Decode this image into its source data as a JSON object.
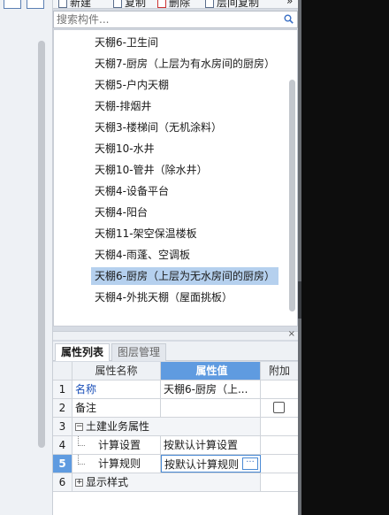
{
  "toolbar": {
    "new_label": "新建",
    "copy_label": "复制",
    "delete_label": "删除",
    "floor_copy_label": "层间复制",
    "more_label": "»"
  },
  "search": {
    "placeholder": "搜索构件..."
  },
  "components": [
    "天棚6-卫生间",
    "天棚7-厨房（上层为有水房间的厨房）",
    "天棚5-户内天棚",
    "天棚-排烟井",
    "天棚3-楼梯间（无机涂料）",
    "天棚10-水井",
    "天棚10-管井（除水井）",
    "天棚4-设备平台",
    "天棚4-阳台",
    "天棚11-架空保温楼板",
    "天棚4-雨蓬、空调板",
    "天棚6-厨房（上层为无水房间的厨房）",
    "天棚4-外挑天棚（屋面挑板）"
  ],
  "selected_index": 11,
  "props": {
    "tabs": [
      "属性列表",
      "图层管理"
    ],
    "headers": {
      "name": "属性名称",
      "value": "属性值",
      "add": "附加"
    },
    "rows": [
      {
        "num": "1",
        "name": "名称",
        "value": "天棚6-厨房（上..."
      },
      {
        "num": "2",
        "name": "备注",
        "value": ""
      },
      {
        "num": "3",
        "name": "土建业务属性",
        "value": ""
      },
      {
        "num": "4",
        "name": "计算设置",
        "value": "按默认计算设置"
      },
      {
        "num": "5",
        "name": "计算规则",
        "value": "按默认计算规则"
      },
      {
        "num": "6",
        "name": "显示样式",
        "value": ""
      }
    ],
    "close_label": "×",
    "ellipsis_label": "···"
  },
  "colors": {
    "selection": "#b5d0ee",
    "header_active": "#5f9be0",
    "link_blue": "#1a4fb8"
  }
}
